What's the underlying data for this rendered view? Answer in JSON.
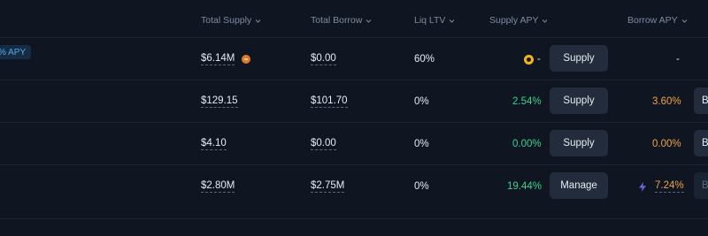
{
  "header": {
    "total_supply": "Total Supply",
    "total_borrow": "Total Borrow",
    "liq_ltv": "Liq LTV",
    "supply_apy": "Supply APY",
    "borrow_apy": "Borrow APY"
  },
  "badge": {
    "apy_label": "% APY"
  },
  "rows": [
    {
      "total_supply": "$6.14M",
      "total_borrow": "$0.00",
      "liq_ltv": "60%",
      "supply_apy": "-",
      "supply_button": "Supply",
      "borrow_apy": "-",
      "edge_button": ""
    },
    {
      "total_supply": "$129.15",
      "total_borrow": "$101.70",
      "liq_ltv": "0%",
      "supply_apy": "2.54%",
      "supply_button": "Supply",
      "borrow_apy": "3.60%",
      "edge_button": "B"
    },
    {
      "total_supply": "$4.10",
      "total_borrow": "$0.00",
      "liq_ltv": "0%",
      "supply_apy": "0.00%",
      "supply_button": "Supply",
      "borrow_apy": "0.00%",
      "edge_button": "B"
    },
    {
      "total_supply": "$2.80M",
      "total_borrow": "$2.75M",
      "liq_ltv": "0%",
      "supply_apy": "19.44%",
      "supply_button": "Manage",
      "borrow_apy": "7.24%",
      "edge_button": "B"
    }
  ],
  "colors": {
    "background": "#0f1621",
    "supply_apy_green": "#3fcf8e",
    "borrow_apy_orange": "#f0a24a",
    "button_bg": "#222c3c"
  },
  "icons": {
    "sort": "chevron-down-icon",
    "row0_supply_asset": "orange-coin-icon",
    "row0_supply_apy_asset": "gold-coin-icon",
    "row3_borrow_boost": "lightning-bolt-icon"
  }
}
